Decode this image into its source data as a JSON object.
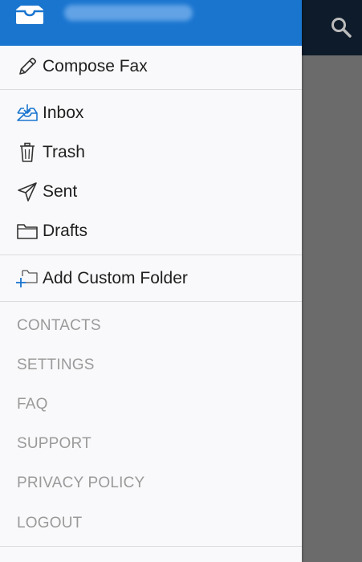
{
  "header": {
    "account_label": "",
    "accent_color": "#1a75cf"
  },
  "menu": {
    "compose": {
      "label": "Compose Fax",
      "icon": "pencil-icon"
    },
    "folders": [
      {
        "label": "Inbox",
        "icon": "inbox-tray-icon"
      },
      {
        "label": "Trash",
        "icon": "trash-icon"
      },
      {
        "label": "Sent",
        "icon": "paper-plane-icon"
      },
      {
        "label": "Drafts",
        "icon": "folder-icon"
      }
    ],
    "add_folder": {
      "label": "Add Custom Folder",
      "icon": "add-folder-icon"
    },
    "links": [
      {
        "label": "CONTACTS"
      },
      {
        "label": "SETTINGS"
      },
      {
        "label": "FAQ"
      },
      {
        "label": "SUPPORT"
      },
      {
        "label": "PRIVACY POLICY"
      },
      {
        "label": "LOGOUT"
      }
    ]
  },
  "toolbar": {
    "search_icon": "search-icon"
  }
}
